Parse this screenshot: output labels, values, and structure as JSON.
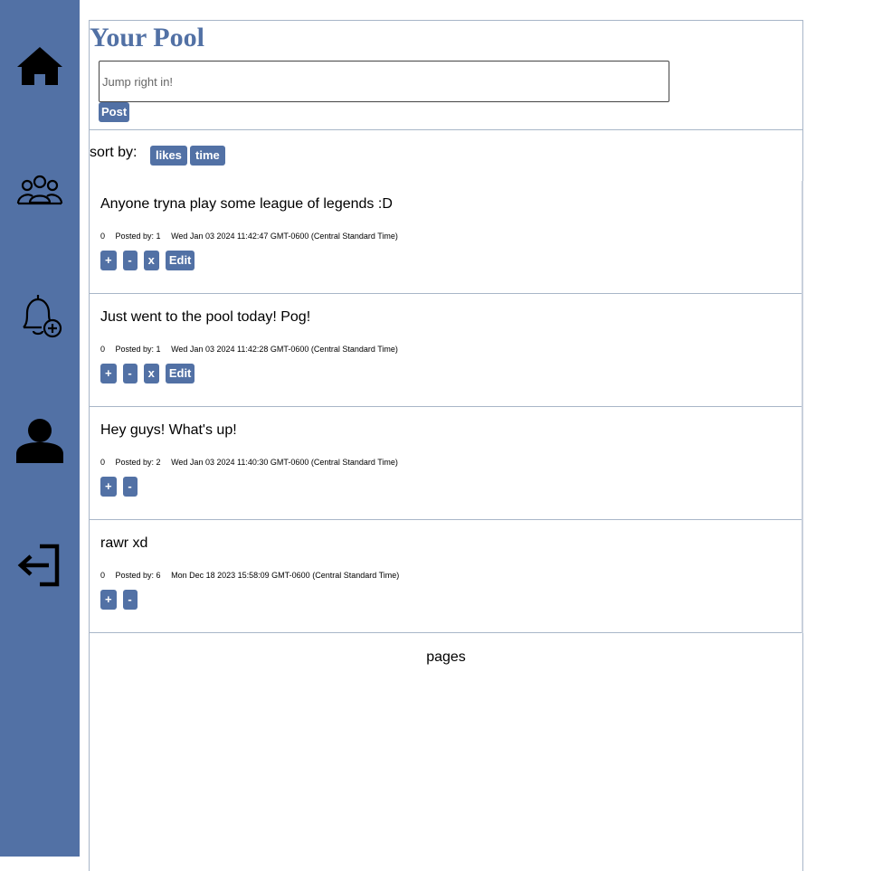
{
  "nav": {
    "items": [
      {
        "icon": "home-icon"
      },
      {
        "icon": "group-icon"
      },
      {
        "icon": "bell-add-icon"
      },
      {
        "icon": "person-icon"
      },
      {
        "icon": "logout-icon"
      }
    ]
  },
  "page": {
    "title": "Your Pool"
  },
  "composer": {
    "placeholder": "Jump right in!",
    "post_label": "Post"
  },
  "sort": {
    "label": "sort by:",
    "likes_label": "likes",
    "time_label": "time"
  },
  "posts": [
    {
      "text": "Anyone tryna play some league of legends :D",
      "likes": "0",
      "posted_by": "Posted by: 1",
      "timestamp": "Wed Jan 03 2024 11:42:47 GMT-0600 (Central Standard Time)",
      "actions": [
        "+",
        "-",
        "x",
        "Edit"
      ]
    },
    {
      "text": "Just went to the pool today! Pog!",
      "likes": "0",
      "posted_by": "Posted by: 1",
      "timestamp": "Wed Jan 03 2024 11:42:28 GMT-0600 (Central Standard Time)",
      "actions": [
        "+",
        "-",
        "x",
        "Edit"
      ]
    },
    {
      "text": "Hey guys! What's up!",
      "likes": "0",
      "posted_by": "Posted by: 2",
      "timestamp": "Wed Jan 03 2024 11:40:30 GMT-0600 (Central Standard Time)",
      "actions": [
        "+",
        "-"
      ]
    },
    {
      "text": "rawr xd",
      "likes": "0",
      "posted_by": "Posted by: 6",
      "timestamp": "Mon Dec 18 2023 15:58:09 GMT-0600 (Central Standard Time)",
      "actions": [
        "+",
        "-"
      ]
    }
  ],
  "pagination": {
    "label": "pages"
  },
  "colors": {
    "accent": "#5271a5",
    "border": "#a8b6c8"
  }
}
